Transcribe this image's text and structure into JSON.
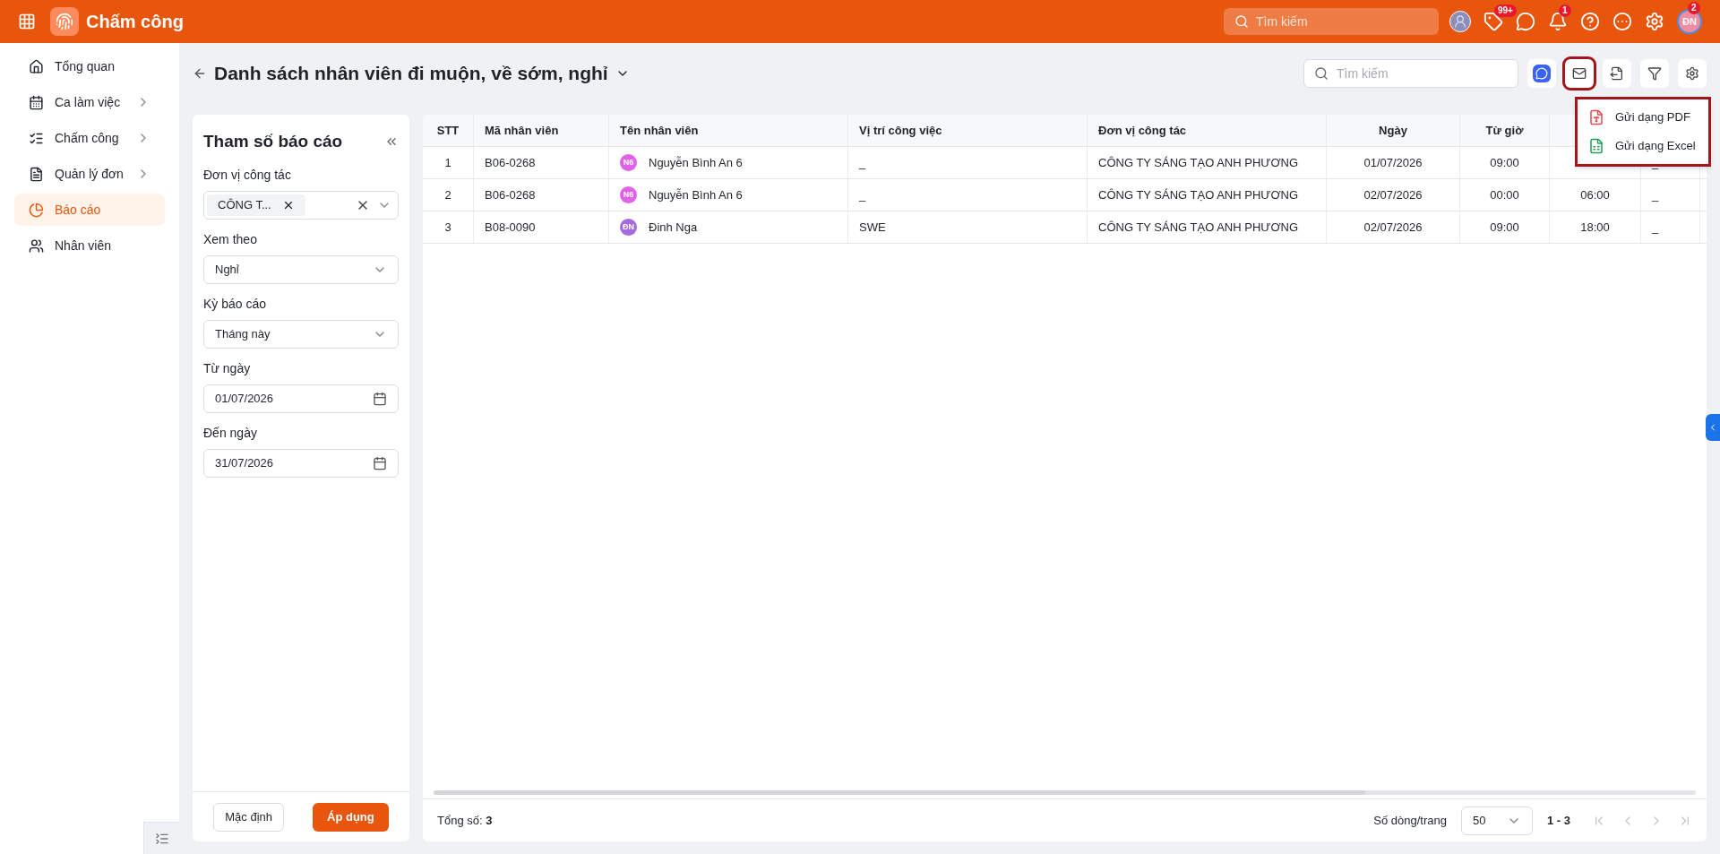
{
  "topbar": {
    "app_title": "Chấm công",
    "search": {
      "placeholder": "Tìm kiếm"
    },
    "icons": [
      {
        "kind": "avatar"
      },
      {
        "kind": "tag",
        "badge": "99+"
      },
      {
        "kind": "chat"
      },
      {
        "kind": "bell",
        "badge": "1"
      },
      {
        "kind": "help"
      },
      {
        "kind": "more"
      },
      {
        "kind": "settings"
      },
      {
        "kind": "user",
        "initials": "ĐN",
        "badge": "2"
      }
    ]
  },
  "sidebar": {
    "items": [
      {
        "kind": "home",
        "label": "Tổng quan",
        "has_children": false,
        "selected": false
      },
      {
        "kind": "calendar",
        "label": "Ca làm việc",
        "has_children": true,
        "selected": false
      },
      {
        "kind": "checklist",
        "label": "Chấm công",
        "has_children": true,
        "selected": false
      },
      {
        "kind": "document",
        "label": "Quản lý đơn",
        "has_children": true,
        "selected": false
      },
      {
        "kind": "chart",
        "label": "Báo cáo",
        "has_children": false,
        "selected": true
      },
      {
        "kind": "users",
        "label": "Nhân viên",
        "has_children": false,
        "selected": false
      }
    ]
  },
  "page": {
    "title": "Danh sách nhân viên đi muộn, về sớm, nghỉ",
    "search": {
      "placeholder": "Tìm kiếm"
    },
    "toolbar": [
      {
        "kind": "messenger",
        "highlighted": false
      },
      {
        "kind": "mail",
        "highlighted": true
      },
      {
        "kind": "export",
        "highlighted": false
      },
      {
        "kind": "filter",
        "highlighted": false
      },
      {
        "kind": "settings",
        "highlighted": false
      }
    ],
    "send_menu": {
      "highlighted": true,
      "items": [
        {
          "kind": "pdf",
          "label": "Gửi dạng PDF"
        },
        {
          "kind": "excel",
          "label": "Gửi dạng Excel"
        }
      ]
    }
  },
  "params": {
    "title": "Tham số báo cáo",
    "fields": [
      {
        "kind": "multiselect",
        "label": "Đơn vị công tác",
        "tags": [
          "CÔNG T..."
        ]
      },
      {
        "kind": "select",
        "label": "Xem theo",
        "value": "Nghỉ"
      },
      {
        "kind": "select",
        "label": "Kỳ báo cáo",
        "value": "Tháng này"
      },
      {
        "kind": "date",
        "label": "Từ ngày",
        "value": "01/07/2026"
      },
      {
        "kind": "date",
        "label": "Đến ngày",
        "value": "31/07/2026"
      }
    ],
    "buttons": [
      {
        "kind": "secondary",
        "label": "Mặc định"
      },
      {
        "kind": "primary",
        "label": "Áp dụng"
      }
    ]
  },
  "table": {
    "columns": [
      "STT",
      "Mã nhân viên",
      "Tên nhân viên",
      "Vị trí công việc",
      "Đơn vị công tác",
      "Ngày",
      "Từ giờ",
      null,
      null
    ],
    "rows": [
      {
        "cells": [
          "1",
          "B06-0268",
          "Nguyễn Bình An 6",
          "_",
          "CÔNG TY SÁNG TẠO ANH PHƯƠNG",
          "01/07/2026",
          "09:00",
          null,
          "_"
        ],
        "avatar": "N6",
        "color": "#e062e6"
      },
      {
        "cells": [
          "2",
          "B06-0268",
          "Nguyễn Bình An 6",
          "_",
          "CÔNG TY SÁNG TẠO ANH PHƯƠNG",
          "02/07/2026",
          "00:00",
          "06:00",
          "_"
        ],
        "avatar": "N6",
        "color": "#e062e6"
      },
      {
        "cells": [
          "3",
          "B08-0090",
          "Đinh Nga",
          "SWE",
          "CÔNG TY SÁNG TẠO ANH PHƯƠNG",
          "02/07/2026",
          "09:00",
          "18:00",
          "_"
        ],
        "avatar": "ĐN",
        "color": "#a66ae0"
      }
    ],
    "footer": {
      "total": "Tổng số: **3**",
      "page_size_label": "Số dòng/trang",
      "page_size": "50",
      "range": "1 - 3"
    }
  }
}
